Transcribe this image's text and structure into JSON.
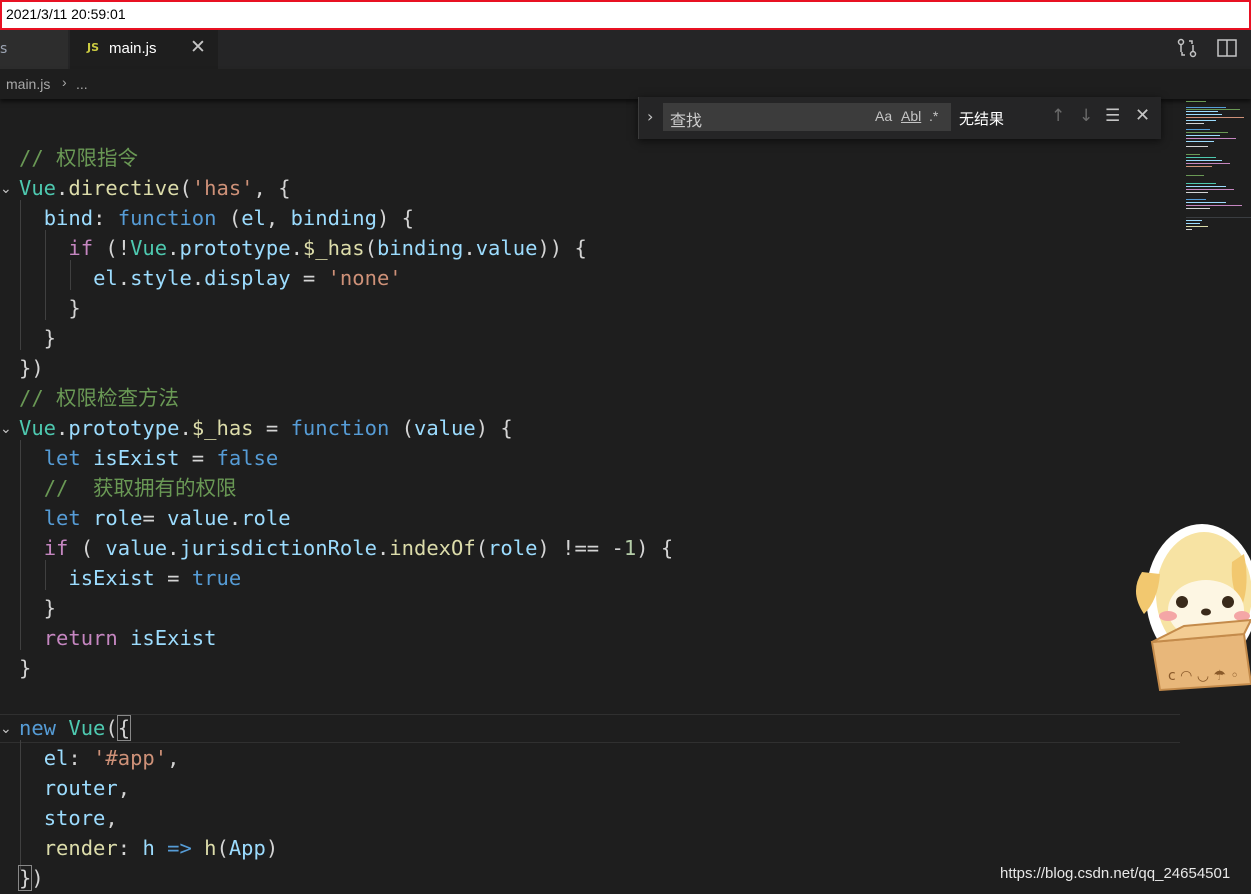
{
  "timestamp": "2021/3/11 20:59:01",
  "tabs": {
    "previous_partial": "s",
    "active": {
      "icon_text": "JS",
      "label": "main.js",
      "close_glyph": "✕"
    }
  },
  "breadcrumb": {
    "file": "main.js",
    "separator": "›",
    "more": "..."
  },
  "find_widget": {
    "placeholder": "查找",
    "options": [
      "Aa",
      "Abl",
      ".*"
    ],
    "result": "无结果"
  },
  "code": {
    "comment1": "// 权限指令",
    "comment2": "// 权限检查方法",
    "comment3": "//  获取拥有的权限"
  },
  "watermark": "https://blog.csdn.net/qq_24654501",
  "colors": {
    "comment": "#6a9955",
    "keyword": "#569cd6",
    "control": "#c586c0",
    "class": "#4ec9b0",
    "string": "#ce9178",
    "variable": "#9cdcfe",
    "function": "#dcdcaa",
    "number": "#b5cea8"
  }
}
